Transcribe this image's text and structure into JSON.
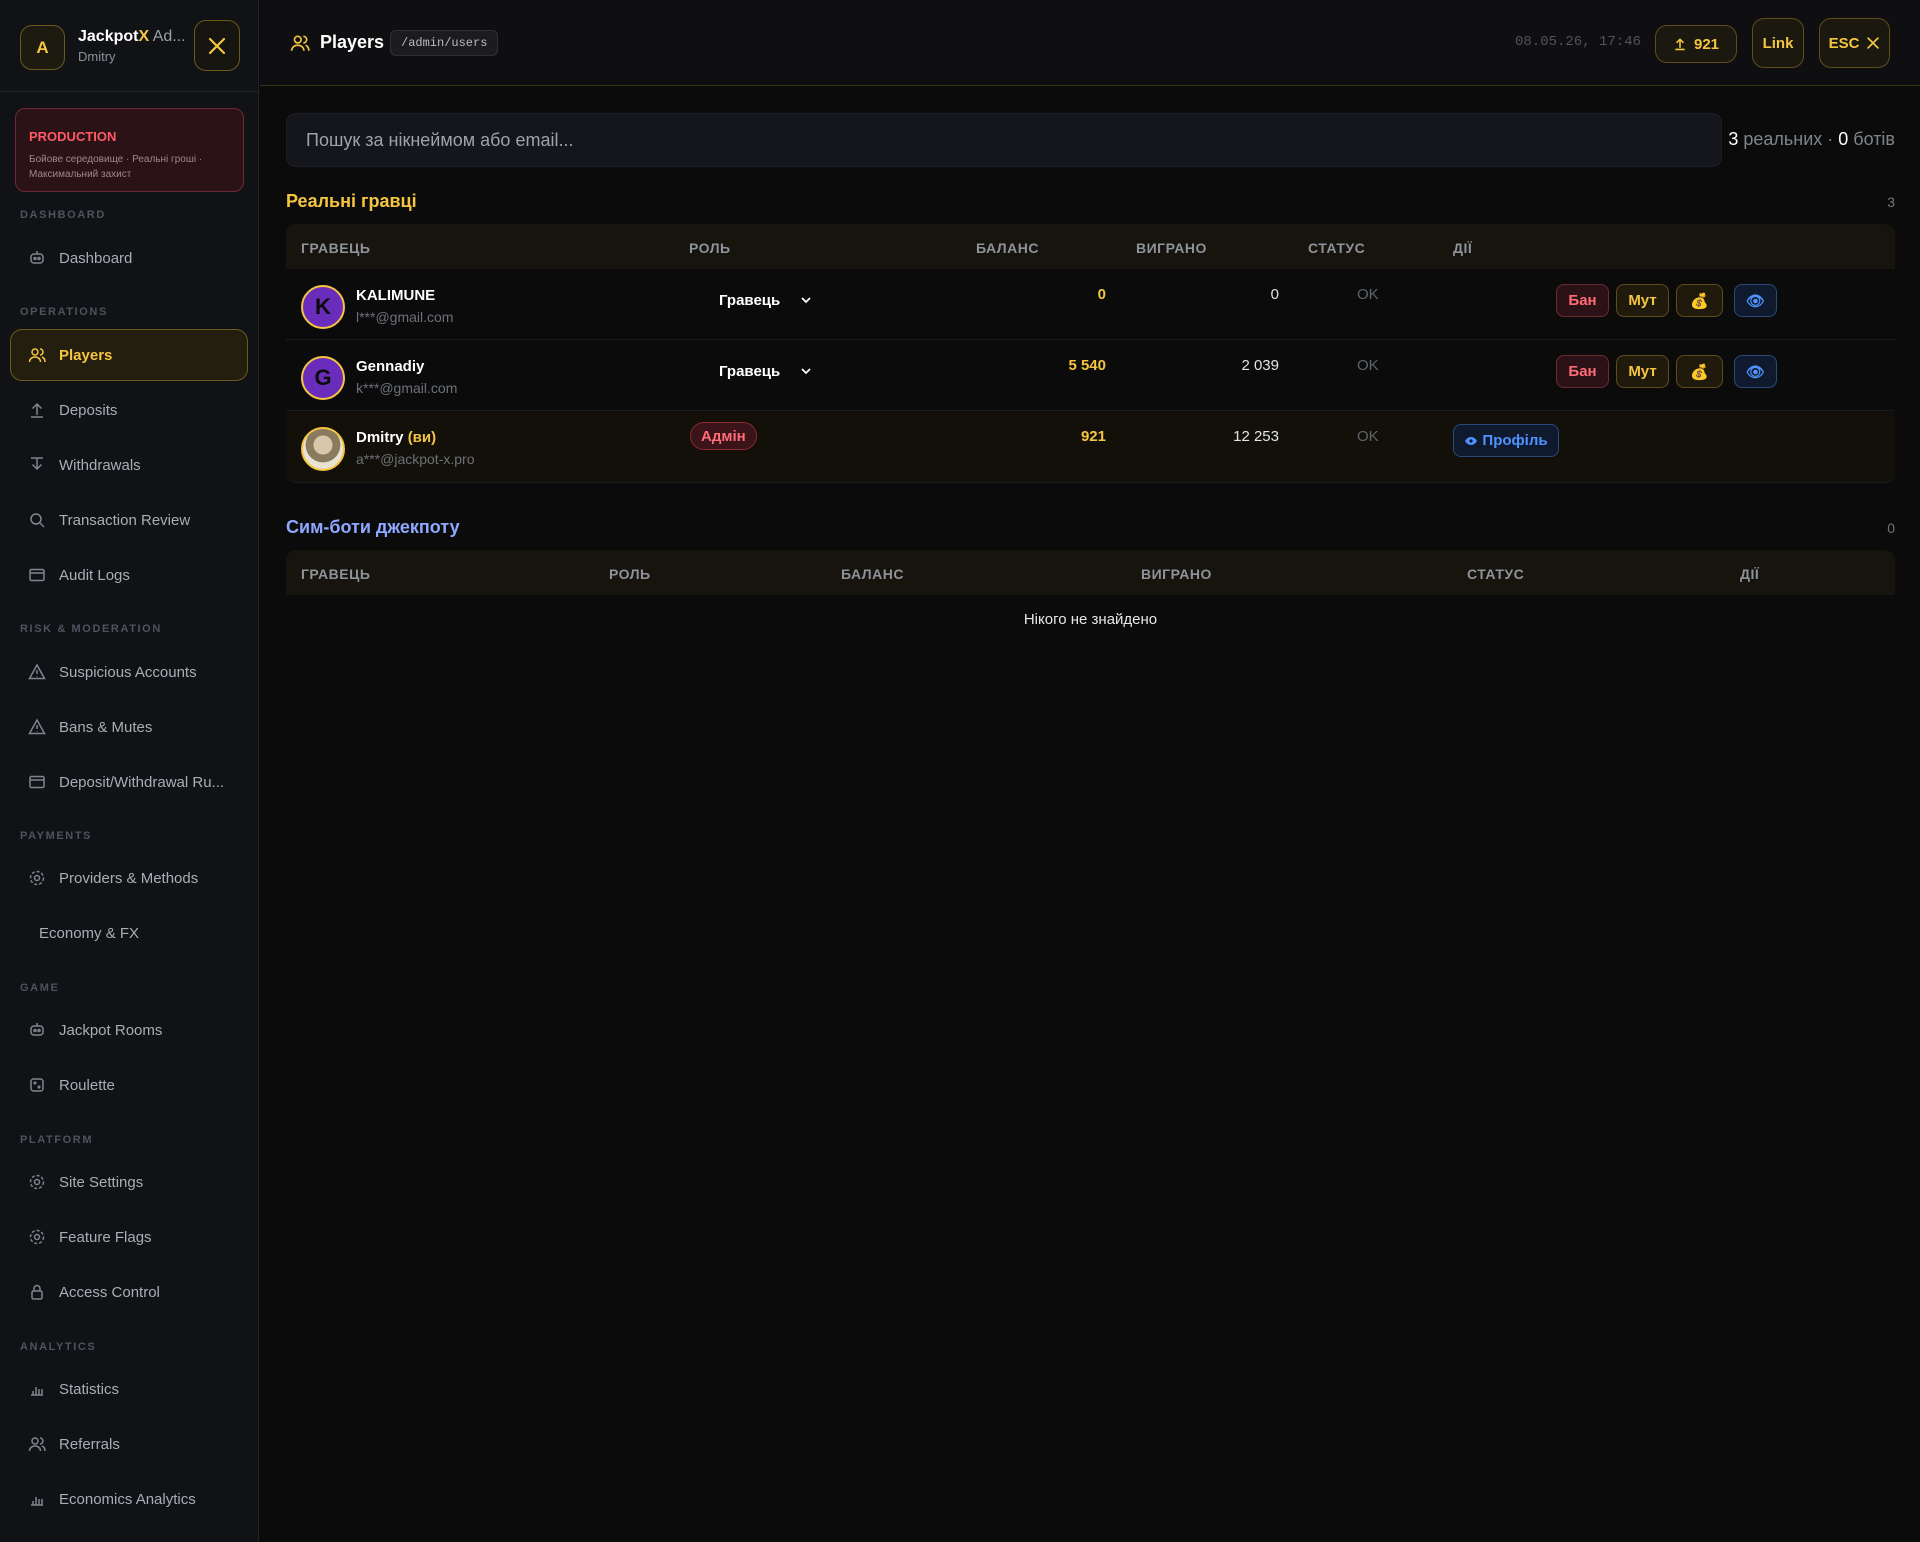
{
  "sidebar": {
    "avatar_letter": "A",
    "brand": {
      "part1": "Jackpot",
      "part2": "X",
      "part3": " Ad..."
    },
    "user": "Dmitry",
    "env": {
      "title": "PRODUCTION",
      "line1": "Бойове середовище · Реальні гроші ·",
      "line2": "Максимальний захист"
    },
    "sections": {
      "dashboard": "DASHBOARD",
      "operations": "OPERATIONS",
      "risk": "RISK & MODERATION",
      "payments": "PAYMENTS",
      "game": "GAME",
      "platform": "PLATFORM",
      "analytics": "ANALYTICS"
    },
    "items": {
      "dashboard": "Dashboard",
      "players": "Players",
      "deposits": "Deposits",
      "withdrawals": "Withdrawals",
      "transaction_review": "Transaction Review",
      "audit_logs": "Audit Logs",
      "suspicious": "Suspicious Accounts",
      "bans": "Bans & Mutes",
      "dw_rules": "Deposit/Withdrawal Ru...",
      "providers": "Providers & Methods",
      "economy": "Economy & FX",
      "jackpot_rooms": "Jackpot Rooms",
      "roulette": "Roulette",
      "site_settings": "Site Settings",
      "feature_flags": "Feature Flags",
      "access_control": "Access Control",
      "statistics": "Statistics",
      "referrals": "Referrals",
      "economics_analytics": "Economics Analytics"
    }
  },
  "topbar": {
    "title": "Players",
    "path": "/admin/users",
    "datetime": "08.05.26, 17:46",
    "balance": "921",
    "link_label": "Link",
    "esc_label": "ESC"
  },
  "search": {
    "placeholder": "Пошук за нікнеймом або email..."
  },
  "counts": {
    "real": "3",
    "real_label": " реальних · ",
    "bots": "0",
    "bots_label": " ботів"
  },
  "real_players": {
    "title": "Реальні гравці",
    "count": "3",
    "headers": {
      "player": "ГРАВЕЦЬ",
      "role": "РОЛЬ",
      "balance": "БАЛАНС",
      "won": "ВИГРАНО",
      "status": "СТАТУС",
      "actions": "ДІЇ"
    },
    "rows": [
      {
        "initial": "K",
        "name": "KALIMUNE",
        "email": "l***@gmail.com",
        "role": "Гравець",
        "balance": "0",
        "won": "0",
        "status": "OK"
      },
      {
        "initial": "G",
        "name": "Gennadiy",
        "email": "k***@gmail.com",
        "role": "Гравець",
        "balance": "5 540",
        "won": "2 039",
        "status": "OK"
      },
      {
        "initial": "",
        "name": "Dmitry",
        "you": "(ви)",
        "email": "a***@jackpot-x.pro",
        "role": "Адмін",
        "balance": "921",
        "won": "12 253",
        "status": "OK"
      }
    ],
    "actions": {
      "ban": "Бан",
      "mute": "Мут",
      "coin": "💰",
      "eye": "👁",
      "profile": "Профіль"
    }
  },
  "bots": {
    "title": "Сим-боти джекпоту",
    "count": "0",
    "headers": {
      "player": "ГРАВЕЦЬ",
      "role": "РОЛЬ",
      "balance": "БАЛАНС",
      "won": "ВИГРАНО",
      "status": "СТАТУС",
      "actions": "ДІЇ"
    },
    "empty": "Нікого не знайдено"
  },
  "colors": {
    "accent": "#f5c542",
    "danger": "#ff5a66",
    "info": "#4f93ff",
    "bots_title": "#8fa8ff"
  }
}
